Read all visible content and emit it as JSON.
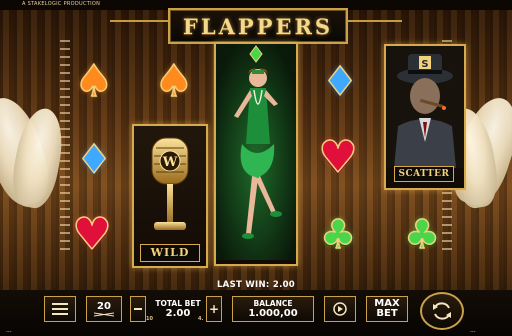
{
  "header": {
    "producer": "A STAKELOGIC PRODUCTION",
    "game_title": "FLAPPERS"
  },
  "reels": [
    {
      "symbols": [
        "spade-orange",
        "diamond-blue",
        "heart-red"
      ]
    },
    {
      "symbols": [
        "spade-orange",
        "wild-microphone"
      ],
      "wild_label": "WILD"
    },
    {
      "symbols": [
        "flapper-dancer"
      ]
    },
    {
      "symbols": [
        "diamond-blue",
        "heart-red",
        "club-green"
      ]
    },
    {
      "symbols": [
        "scatter-gangster",
        "club-green"
      ],
      "scatter_label": "SCATTER"
    }
  ],
  "glyphs": {
    "spade": "♠",
    "diamond": "♦",
    "heart": "♥",
    "club": "♣"
  },
  "win": {
    "text": "LAST WIN: 2.00"
  },
  "controls": {
    "menu_icon": "hamburger-icon",
    "lines": "20",
    "total_bet_label": "TOTAL BET",
    "total_bet_value": "2.00",
    "bet_min": "10",
    "bet_max": "4.",
    "bet_plus": "+",
    "balance_label": "BALANCE",
    "balance_value": "1.000,00",
    "autoplay_icon": "autoplay-icon",
    "max_bet_line1": "MAX",
    "max_bet_line2": "BET",
    "spin_icon": "spin-icon",
    "footer_left": "...",
    "footer_right": "..."
  },
  "colors": {
    "gold": "#c9a24a",
    "accent_orange": "#ff8a1e",
    "accent_green": "#49d64a"
  }
}
